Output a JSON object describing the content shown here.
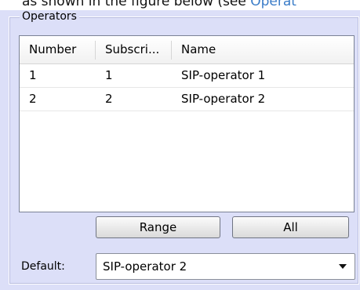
{
  "caption": {
    "prefix": "as shown in the figure below (see ",
    "link": "Operat"
  },
  "group": {
    "title": "Operators"
  },
  "table": {
    "columns": [
      "Number",
      "Subscri...",
      "Name"
    ],
    "rows": [
      [
        "1",
        "1",
        "SIP-operator 1"
      ],
      [
        "2",
        "2",
        "SIP-operator 2"
      ]
    ]
  },
  "buttons": {
    "range": "Range",
    "all": "All"
  },
  "default_field": {
    "label": "Default:",
    "value": "SIP-operator 2",
    "icon": "chevron-down-icon"
  }
}
